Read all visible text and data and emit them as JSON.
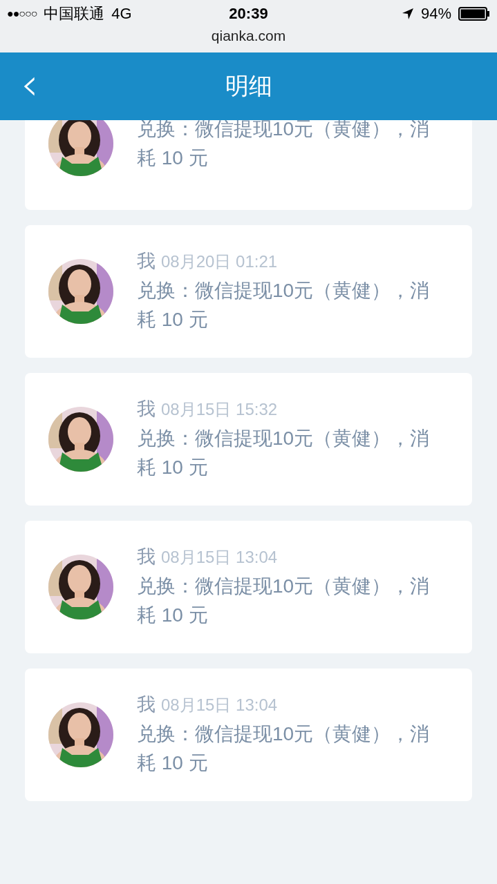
{
  "status_bar": {
    "signal": "●●○○○",
    "carrier": "中国联通",
    "network": "4G",
    "time": "20:39",
    "battery": "94%"
  },
  "address_bar": {
    "url": "qianka.com"
  },
  "header": {
    "back": "‹",
    "title": "明细"
  },
  "records": [
    {
      "kind": "picture",
      "description": "兑换：微信提现10元（黄健），消耗 10 元"
    },
    {
      "kind": "picture",
      "user": "我",
      "time": "08月20日 01:21",
      "description": "兑换：微信提现10元（黄健），消耗 10 元"
    },
    {
      "kind": "picture",
      "user": "我",
      "time": "08月15日 15:32",
      "description": "兑换：微信提现10元（黄健），消耗 10 元"
    },
    {
      "kind": "picture",
      "user": "我",
      "time": "08月15日 13:04",
      "description": "兑换：微信提现10元（黄健），消耗 10 元"
    },
    {
      "kind": "picture",
      "user": "我",
      "time": "08月15日 13:04",
      "description": "兑换：微信提现10元（黄健），消耗 10 元"
    }
  ]
}
